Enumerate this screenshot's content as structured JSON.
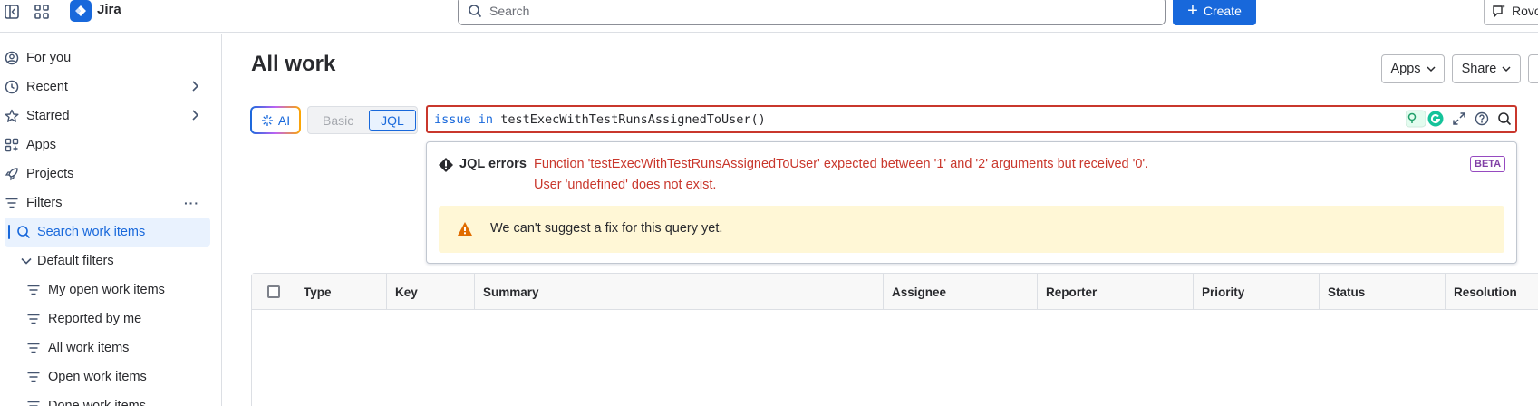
{
  "app": {
    "name": "Jira",
    "search_placeholder": "Search",
    "create_label": "Create",
    "rovo_label": "Rovo"
  },
  "sidebar": {
    "items": [
      {
        "label": "For you",
        "icon": "user-circle-icon"
      },
      {
        "label": "Recent",
        "icon": "clock-icon"
      },
      {
        "label": "Starred",
        "icon": "star-icon"
      },
      {
        "label": "Apps",
        "icon": "apps-icon"
      },
      {
        "label": "Projects",
        "icon": "rocket-icon"
      },
      {
        "label": "Filters",
        "icon": "filter-icon"
      },
      {
        "label": "Search work items",
        "icon": "search-icon"
      },
      {
        "label": "Default filters",
        "icon": "chevron-down-icon"
      },
      {
        "label": "My open work items",
        "icon": "filter-icon"
      },
      {
        "label": "Reported by me",
        "icon": "filter-icon"
      },
      {
        "label": "All work items",
        "icon": "filter-icon"
      },
      {
        "label": "Open work items",
        "icon": "filter-icon"
      },
      {
        "label": "Done work items",
        "icon": "filter-icon"
      }
    ]
  },
  "main": {
    "title": "All work",
    "apps_label": "Apps",
    "share_label": "Share",
    "ai_label": "AI",
    "basic_label": "Basic",
    "jql_label": "JQL",
    "query": {
      "keyword1": "issue",
      "keyword2": "in",
      "function": "testExecWithTestRunsAssignedToUser()"
    },
    "errors": {
      "title": "JQL errors",
      "line1": "Function 'testExecWithTestRunsAssignedToUser' expected between '1' and '2' arguments but received '0'.",
      "line2": "User 'undefined' does not exist.",
      "beta": "BETA",
      "warning": "We can't suggest a fix for this query yet."
    },
    "table": {
      "columns": [
        "Type",
        "Key",
        "Summary",
        "Assignee",
        "Reporter",
        "Priority",
        "Status",
        "Resolution"
      ]
    }
  },
  "colors": {
    "brand": "#1868db",
    "error": "#c9372c",
    "warning_bg": "#fff7d6",
    "warning_icon": "#e06c00",
    "beta": "#803fa5"
  }
}
